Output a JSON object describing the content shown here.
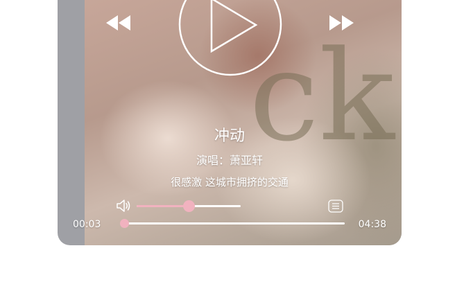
{
  "song": {
    "title": "冲动",
    "singer_line": "演唱：萧亚轩",
    "lyric": "很感激 这城市拥挤的交通"
  },
  "playback": {
    "current_time": "00:03",
    "total_time": "04:38",
    "progress_fraction": 0.012
  },
  "volume": {
    "level_fraction": 0.5
  },
  "icons": {
    "prev": "rewind-icon",
    "play": "play-icon",
    "next": "fast-forward-icon",
    "volume": "speaker-icon",
    "playlist": "playlist-icon"
  },
  "colors": {
    "accent": "#f1b2bf",
    "foreground": "#ffffff"
  }
}
